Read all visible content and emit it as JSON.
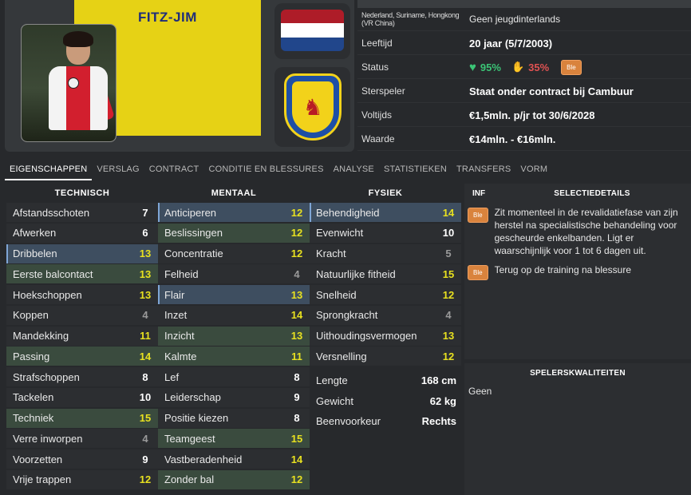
{
  "player": {
    "name": "FITZ-JIM"
  },
  "info": {
    "nationality_label": "Nederland, Suriname, Hongkong (VR China)",
    "nationality_value": "Geen jeugdinterlands",
    "age_label": "Leeftijd",
    "age_value": "20 jaar (5/7/2003)",
    "status_label": "Status",
    "status_happiness": "95%",
    "status_fitness": "35%",
    "status_badge": "Ble",
    "star_label": "Sterspeler",
    "star_value": "Staat onder contract bij Cambuur",
    "contract_label": "Voltijds",
    "contract_value": "€1,5mln. p/jr tot 30/6/2028",
    "value_label": "Waarde",
    "value_value": "€14mln. - €16mln."
  },
  "tabs": [
    {
      "label": "EIGENSCHAPPEN"
    },
    {
      "label": "VERSLAG"
    },
    {
      "label": "CONTRACT"
    },
    {
      "label": "CONDITIE EN BLESSURES"
    },
    {
      "label": "ANALYSE"
    },
    {
      "label": "STATISTIEKEN"
    },
    {
      "label": "TRANSFERS"
    },
    {
      "label": "VORM"
    }
  ],
  "technical": {
    "title": "TECHNISCH",
    "attributes": [
      {
        "name": "Afstandsschoten",
        "value": "7",
        "color": "white",
        "hl": ""
      },
      {
        "name": "Afwerken",
        "value": "6",
        "color": "white",
        "hl": ""
      },
      {
        "name": "Dribbelen",
        "value": "13",
        "color": "yellow",
        "hl": "blue"
      },
      {
        "name": "Eerste balcontact",
        "value": "13",
        "color": "yellow",
        "hl": "green"
      },
      {
        "name": "Hoekschoppen",
        "value": "13",
        "color": "yellow",
        "hl": ""
      },
      {
        "name": "Koppen",
        "value": "4",
        "color": "grey",
        "hl": ""
      },
      {
        "name": "Mandekking",
        "value": "11",
        "color": "yellow",
        "hl": ""
      },
      {
        "name": "Passing",
        "value": "14",
        "color": "yellow",
        "hl": "green"
      },
      {
        "name": "Strafschoppen",
        "value": "8",
        "color": "white",
        "hl": ""
      },
      {
        "name": "Tackelen",
        "value": "10",
        "color": "white",
        "hl": ""
      },
      {
        "name": "Techniek",
        "value": "15",
        "color": "yellow",
        "hl": "green"
      },
      {
        "name": "Verre inworpen",
        "value": "4",
        "color": "grey",
        "hl": ""
      },
      {
        "name": "Voorzetten",
        "value": "9",
        "color": "white",
        "hl": ""
      },
      {
        "name": "Vrije trappen",
        "value": "12",
        "color": "yellow",
        "hl": ""
      }
    ]
  },
  "mental": {
    "title": "MENTAAL",
    "attributes": [
      {
        "name": "Anticiperen",
        "value": "12",
        "color": "yellow",
        "hl": "blue"
      },
      {
        "name": "Beslissingen",
        "value": "12",
        "color": "yellow",
        "hl": "green"
      },
      {
        "name": "Concentratie",
        "value": "12",
        "color": "yellow",
        "hl": ""
      },
      {
        "name": "Felheid",
        "value": "4",
        "color": "grey",
        "hl": ""
      },
      {
        "name": "Flair",
        "value": "13",
        "color": "yellow",
        "hl": "blue"
      },
      {
        "name": "Inzet",
        "value": "14",
        "color": "yellow",
        "hl": ""
      },
      {
        "name": "Inzicht",
        "value": "13",
        "color": "yellow",
        "hl": "green"
      },
      {
        "name": "Kalmte",
        "value": "11",
        "color": "yellow",
        "hl": "green"
      },
      {
        "name": "Lef",
        "value": "8",
        "color": "white",
        "hl": ""
      },
      {
        "name": "Leiderschap",
        "value": "9",
        "color": "white",
        "hl": ""
      },
      {
        "name": "Positie kiezen",
        "value": "8",
        "color": "white",
        "hl": ""
      },
      {
        "name": "Teamgeest",
        "value": "15",
        "color": "yellow",
        "hl": "green"
      },
      {
        "name": "Vastberadenheid",
        "value": "14",
        "color": "yellow",
        "hl": ""
      },
      {
        "name": "Zonder bal",
        "value": "12",
        "color": "yellow",
        "hl": "green"
      }
    ]
  },
  "physical": {
    "title": "FYSIEK",
    "attributes": [
      {
        "name": "Behendigheid",
        "value": "14",
        "color": "yellow",
        "hl": "blue"
      },
      {
        "name": "Evenwicht",
        "value": "10",
        "color": "white",
        "hl": ""
      },
      {
        "name": "Kracht",
        "value": "5",
        "color": "grey",
        "hl": ""
      },
      {
        "name": "Natuurlijke fitheid",
        "value": "15",
        "color": "yellow",
        "hl": ""
      },
      {
        "name": "Snelheid",
        "value": "12",
        "color": "yellow",
        "hl": ""
      },
      {
        "name": "Sprongkracht",
        "value": "4",
        "color": "grey",
        "hl": ""
      },
      {
        "name": "Uithoudingsvermogen",
        "value": "13",
        "color": "yellow",
        "hl": ""
      },
      {
        "name": "Versnelling",
        "value": "12",
        "color": "yellow",
        "hl": ""
      }
    ],
    "details": [
      {
        "name": "Lengte",
        "value": "168 cm"
      },
      {
        "name": "Gewicht",
        "value": "62 kg"
      },
      {
        "name": "Beenvoorkeur",
        "value": "Rechts"
      }
    ]
  },
  "selection": {
    "inf_label": "INF",
    "title": "SELECTIEDETAILS",
    "notes": [
      {
        "badge": "Ble",
        "text": "Zit momenteel in de revalidatiefase van zijn herstel na specialistische behandeling voor gescheurde enkelbanden. Ligt er waarschijnlijk voor 1 tot 6 dagen uit."
      },
      {
        "badge": "Ble",
        "text": "Terug op de training na blessure"
      }
    ]
  },
  "qualities": {
    "title": "SPELERSKWALITEITEN",
    "value": "Geen"
  },
  "colors": {
    "highlight_yellow": "#e7e020",
    "kit_yellow": "#e6d215",
    "badge_orange": "#d9833d",
    "happy_green": "#3bc476",
    "warn_red": "#e05252"
  },
  "icons": {
    "happiness": "heart-icon",
    "fitness": "thumbs-down-icon",
    "flag": "netherlands-flag-icon",
    "crest": "club-crest-icon"
  }
}
